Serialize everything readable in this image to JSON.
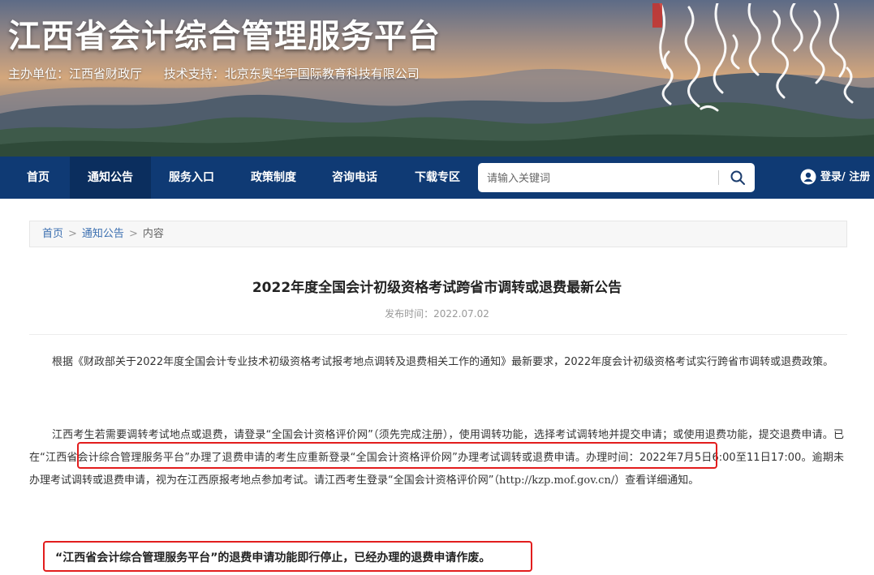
{
  "banner": {
    "title": "江西省会计综合管理服务平台",
    "sponsor": "主办单位：江西省财政厅",
    "support": "技术支持：北京东奥华宇国际教育科技有限公司"
  },
  "nav": {
    "items": [
      {
        "label": "首页"
      },
      {
        "label": "通知公告"
      },
      {
        "label": "服务入口"
      },
      {
        "label": "政策制度"
      },
      {
        "label": "咨询电话"
      },
      {
        "label": "下载专区"
      }
    ],
    "active_index": 1,
    "search_placeholder": "请输入关键词",
    "login_label": "登录/ 注册"
  },
  "breadcrumb": {
    "home": "首页",
    "section": "通知公告",
    "current": "内容",
    "separator": ">"
  },
  "article": {
    "title": "2022年度全国会计初级资格考试跨省市调转或退费最新公告",
    "publish_time": "发布时间：2022.07.02",
    "para1": "根据《财政部关于2022年度全国会计专业技术初级资格考试报考地点调转及退费相关工作的通知》最新要求，2022年度会计初级资格考试实行跨省市调转或退费政策。",
    "para2_a": "江西考生若需要调转考试地点或退费，请登录“全国会计资格评价网”（须先完成注册），使用调转功能，选择考试调转地并提交申请；或使用退费功能，提交退费申请。已在“江西省会计综合管理服务平台”办理了退费申请的考生应重新登录“全国会计资格评价网”办理考试调转或退费申请。办理时间：2022年7月5日6:00至11日17:00。逾期未办理考试调转或退费申请，视为在江西原报考地点参加考试。请江西考生登录“全国会计资格评价网”（",
    "para2_url": "http://kzp.mof.gov.cn/",
    "para2_b": "）查看详细通知。",
    "notice": "“江西省会计综合管理服务平台”的退费申请功能即行停止，已经办理的退费申请作废。"
  },
  "colors": {
    "nav_bg": "#0f3a74",
    "nav_active_bg": "#0b2e5e",
    "highlight_border": "#e21d1d",
    "link": "#3b6fb0"
  },
  "icons": {
    "search": "search-icon",
    "user": "user-icon",
    "calligraphy": "calligraphy-decoration"
  }
}
